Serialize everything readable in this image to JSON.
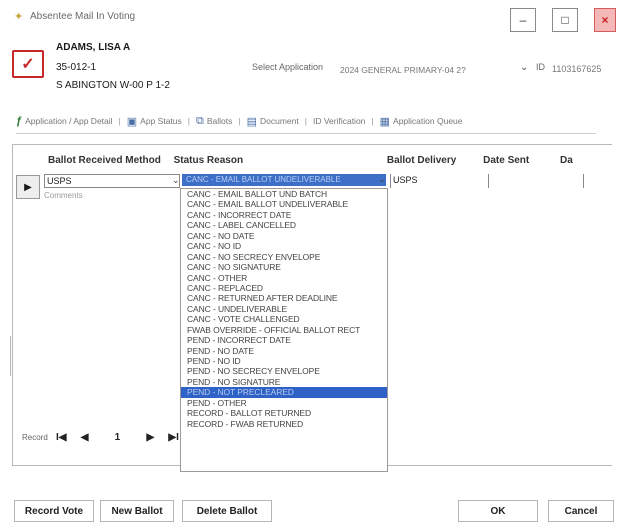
{
  "window": {
    "title": "Absentee Mail In Voting",
    "icon": "star-icon",
    "min_glyph": "–",
    "max_glyph": "□",
    "close_glyph": "×"
  },
  "voter": {
    "name": "ADAMS, LISA A",
    "id": "35-012-1",
    "precinct": "S ABINGTON W-00 P 1-2",
    "icon_glyph": "✓"
  },
  "application": {
    "select_label": "Select Application",
    "select_value": "2024 GENERAL PRIMARY-04 2?",
    "id_label": "ID",
    "id_value": "1103167625"
  },
  "tabs": [
    {
      "label": "Application / App Detail",
      "icon": "application-icon"
    },
    {
      "label": "App Status",
      "icon": "status-icon"
    },
    {
      "label": "Ballots",
      "icon": "ballots-icon"
    },
    {
      "label": "Document",
      "icon": "document-icon"
    },
    {
      "label": "ID Verification",
      "icon": "id-verification-icon"
    },
    {
      "label": "Application Queue",
      "icon": "queue-icon"
    }
  ],
  "grid": {
    "header": "Ballot Received Method   Status Reason                                          Ballot Delivery   Date Sent     Da",
    "row": {
      "method": "USPS",
      "status": "CANC - EMAIL BALLOT UNDELIVERABLE",
      "delivery": "USPS",
      "comments_label": "Comments"
    }
  },
  "dropdown_items": [
    "CANC - EMAIL BALLOT UND BATCH",
    "CANC - EMAIL BALLOT UNDELIVERABLE",
    "CANC - INCORRECT DATE",
    "CANC - LABEL CANCELLED",
    "CANC - NO DATE",
    "CANC - NO ID",
    "CANC - NO SECRECY ENVELOPE",
    "CANC - NO SIGNATURE",
    "CANC - OTHER",
    "CANC - REPLACED",
    "CANC - RETURNED AFTER DEADLINE",
    "CANC - UNDELIVERABLE",
    "CANC - VOTE CHALLENGED",
    "FWAB OVERRIDE - OFFICIAL BALLOT RECT",
    "PEND - INCORRECT DATE",
    "PEND - NO DATE",
    "PEND - NO ID",
    "PEND - NO SECRECY ENVELOPE",
    "PEND - NO SIGNATURE",
    "PEND - NOT PRECLEARED",
    "PEND - OTHER",
    "RECORD - BALLOT RETURNED",
    "RECORD - FWAB RETURNED"
  ],
  "dropdown_highlight_index": 19,
  "record_nav": {
    "label": "Record",
    "first": "I◀",
    "prev": "◀",
    "current": "1",
    "next": "▶",
    "last": "▶I"
  },
  "buttons": {
    "record_vote": "Record Vote",
    "new_ballot": "New Ballot",
    "delete_ballot": "Delete Ballot",
    "ok": "OK",
    "cancel": "Cancel"
  },
  "colors": {
    "selection": "#2f62c7",
    "close_button": "#f4b8b8",
    "voter_icon": "#c62828"
  }
}
